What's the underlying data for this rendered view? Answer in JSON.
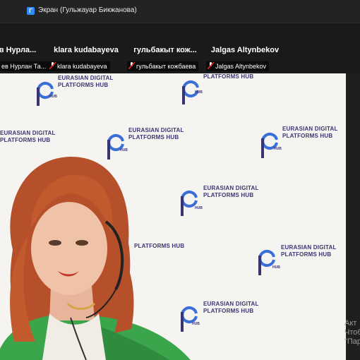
{
  "window": {
    "share_title": "Экран (Гульжауар Бикжанова)"
  },
  "participants": [
    {
      "name": "в Нурла...",
      "label": "ев Нурлан Та..."
    },
    {
      "name": "klara kudabayeva",
      "label": "klara kudabayeva"
    },
    {
      "name": "гульбакыт кож...",
      "label": "гульбакыт кожбаева"
    },
    {
      "name": "Jalgas Altynbekov",
      "label": "Jalgas Altynbekov"
    }
  ],
  "backdrop": {
    "logo_line1": "EURASIAN DIGITAL",
    "logo_line2": "PLATFORMS HUB",
    "logo_hub": "HUB",
    "colors": {
      "gradient_top": "#e1306c",
      "gradient_bottom": "#f5a623",
      "text": "#3a3570"
    }
  },
  "watermark": {
    "line1": "Акт",
    "line2": "Чтоб",
    "line3": "\"Пар"
  }
}
